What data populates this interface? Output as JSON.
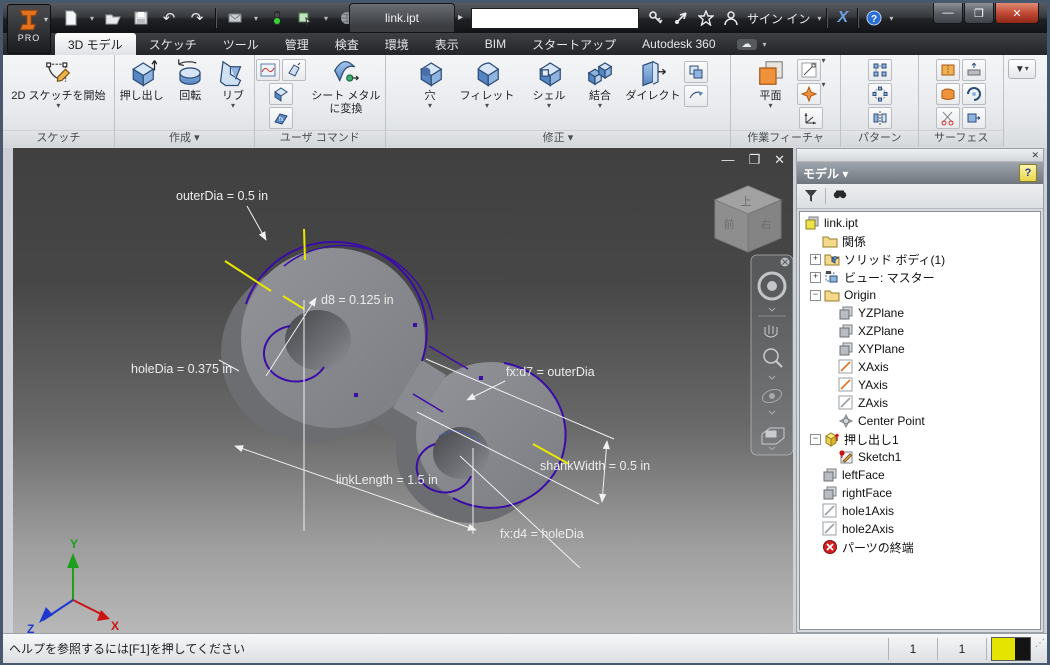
{
  "app": {
    "pro_label": "PRO"
  },
  "titlebar": {
    "document_tab": "link.ipt",
    "sign_in": "サイン イン",
    "search_value": ""
  },
  "icons": {
    "quick_access": [
      "new-file",
      "open-file",
      "save",
      "undo",
      "redo",
      "send-update",
      "traffic-light",
      "insert-object",
      "web",
      "overflow"
    ],
    "titlebar_right": [
      "key",
      "communication-center",
      "favorites",
      "user",
      "exchange-x",
      "help"
    ],
    "window": [
      "minimize",
      "maximize",
      "close"
    ]
  },
  "tabs": [
    {
      "label": "3D モデル",
      "active": true
    },
    {
      "label": "スケッチ",
      "active": false
    },
    {
      "label": "ツール",
      "active": false
    },
    {
      "label": "管理",
      "active": false
    },
    {
      "label": "検査",
      "active": false
    },
    {
      "label": "環境",
      "active": false
    },
    {
      "label": "表示",
      "active": false
    },
    {
      "label": "BIM",
      "active": false
    },
    {
      "label": "スタートアップ",
      "active": false
    },
    {
      "label": "Autodesk 360",
      "active": false
    }
  ],
  "ribbon": {
    "panels": {
      "sketch": {
        "label": "スケッチ",
        "start2d": "2D スケッチを開始"
      },
      "create": {
        "label": "作成 ▾",
        "extrude": "押し出し",
        "revolve": "回転",
        "rib": "リブ"
      },
      "user": {
        "label": "ユーザ コマンド",
        "sheetmetal": "シート メタル に変換"
      },
      "modify": {
        "label": "修正 ▾",
        "hole": "穴",
        "fillet": "フィレット",
        "shell": "シェル",
        "combine": "結合",
        "direct": "ダイレクト"
      },
      "work": {
        "label": "作業フィーチャ",
        "plane": "平面"
      },
      "pattern": {
        "label": "パターン"
      },
      "surface": {
        "label": "サーフェス"
      }
    }
  },
  "viewport": {
    "annotations": [
      {
        "text": "outerDia = 0.5 in"
      },
      {
        "text": "d8 = 0.125 in"
      },
      {
        "text": "holeDia = 0.375 in"
      },
      {
        "text": "fx:d7 = outerDia"
      },
      {
        "text": "shankWidth = 0.5 in"
      },
      {
        "text": "linkLength = 1.5 in"
      },
      {
        "text": "fx:d4 = holeDia"
      }
    ],
    "viewcube": {
      "top": "上",
      "front": "前",
      "right": "右"
    },
    "triad": {
      "x": "X",
      "y": "Y",
      "z": "Z"
    },
    "colors": {
      "edge_highlight": "#3a0ca8",
      "selection_tick": "#e8e800",
      "dimension": "#f0f0f0"
    }
  },
  "browser": {
    "title": "モデル ▾",
    "tree": [
      {
        "label": "link.ipt",
        "exp": "",
        "depth": 0,
        "icon": "part"
      },
      {
        "label": "関係",
        "exp": "",
        "depth": 1,
        "icon": "folder"
      },
      {
        "label": "ソリッド ボディ(1)",
        "exp": "+",
        "depth": 1,
        "icon": "solid-bodies"
      },
      {
        "label": "ビュー: マスター",
        "exp": "+",
        "depth": 1,
        "icon": "view-rep"
      },
      {
        "label": "Origin",
        "exp": "−",
        "depth": 1,
        "icon": "folder"
      },
      {
        "label": "YZPlane",
        "exp": "",
        "depth": 2,
        "icon": "plane"
      },
      {
        "label": "XZPlane",
        "exp": "",
        "depth": 2,
        "icon": "plane"
      },
      {
        "label": "XYPlane",
        "exp": "",
        "depth": 2,
        "icon": "plane"
      },
      {
        "label": "XAxis",
        "exp": "",
        "depth": 2,
        "icon": "axis-active"
      },
      {
        "label": "YAxis",
        "exp": "",
        "depth": 2,
        "icon": "axis-active"
      },
      {
        "label": "ZAxis",
        "exp": "",
        "depth": 2,
        "icon": "axis"
      },
      {
        "label": "Center Point",
        "exp": "",
        "depth": 2,
        "icon": "center-point"
      },
      {
        "label": "押し出し1",
        "exp": "−",
        "depth": 1,
        "icon": "extrusion"
      },
      {
        "label": "Sketch1",
        "exp": "",
        "depth": 2,
        "icon": "sketch"
      },
      {
        "label": "leftFace",
        "exp": "",
        "depth": 1,
        "icon": "plane"
      },
      {
        "label": "rightFace",
        "exp": "",
        "depth": 1,
        "icon": "plane"
      },
      {
        "label": "hole1Axis",
        "exp": "",
        "depth": 1,
        "icon": "axis"
      },
      {
        "label": "hole2Axis",
        "exp": "",
        "depth": 1,
        "icon": "axis"
      },
      {
        "label": "パーツの終端",
        "exp": "",
        "depth": 1,
        "icon": "end-of-part"
      }
    ]
  },
  "statusbar": {
    "help_text": "ヘルプを参照するには[F1]を押してください",
    "cell1": "1",
    "cell2": "1"
  }
}
